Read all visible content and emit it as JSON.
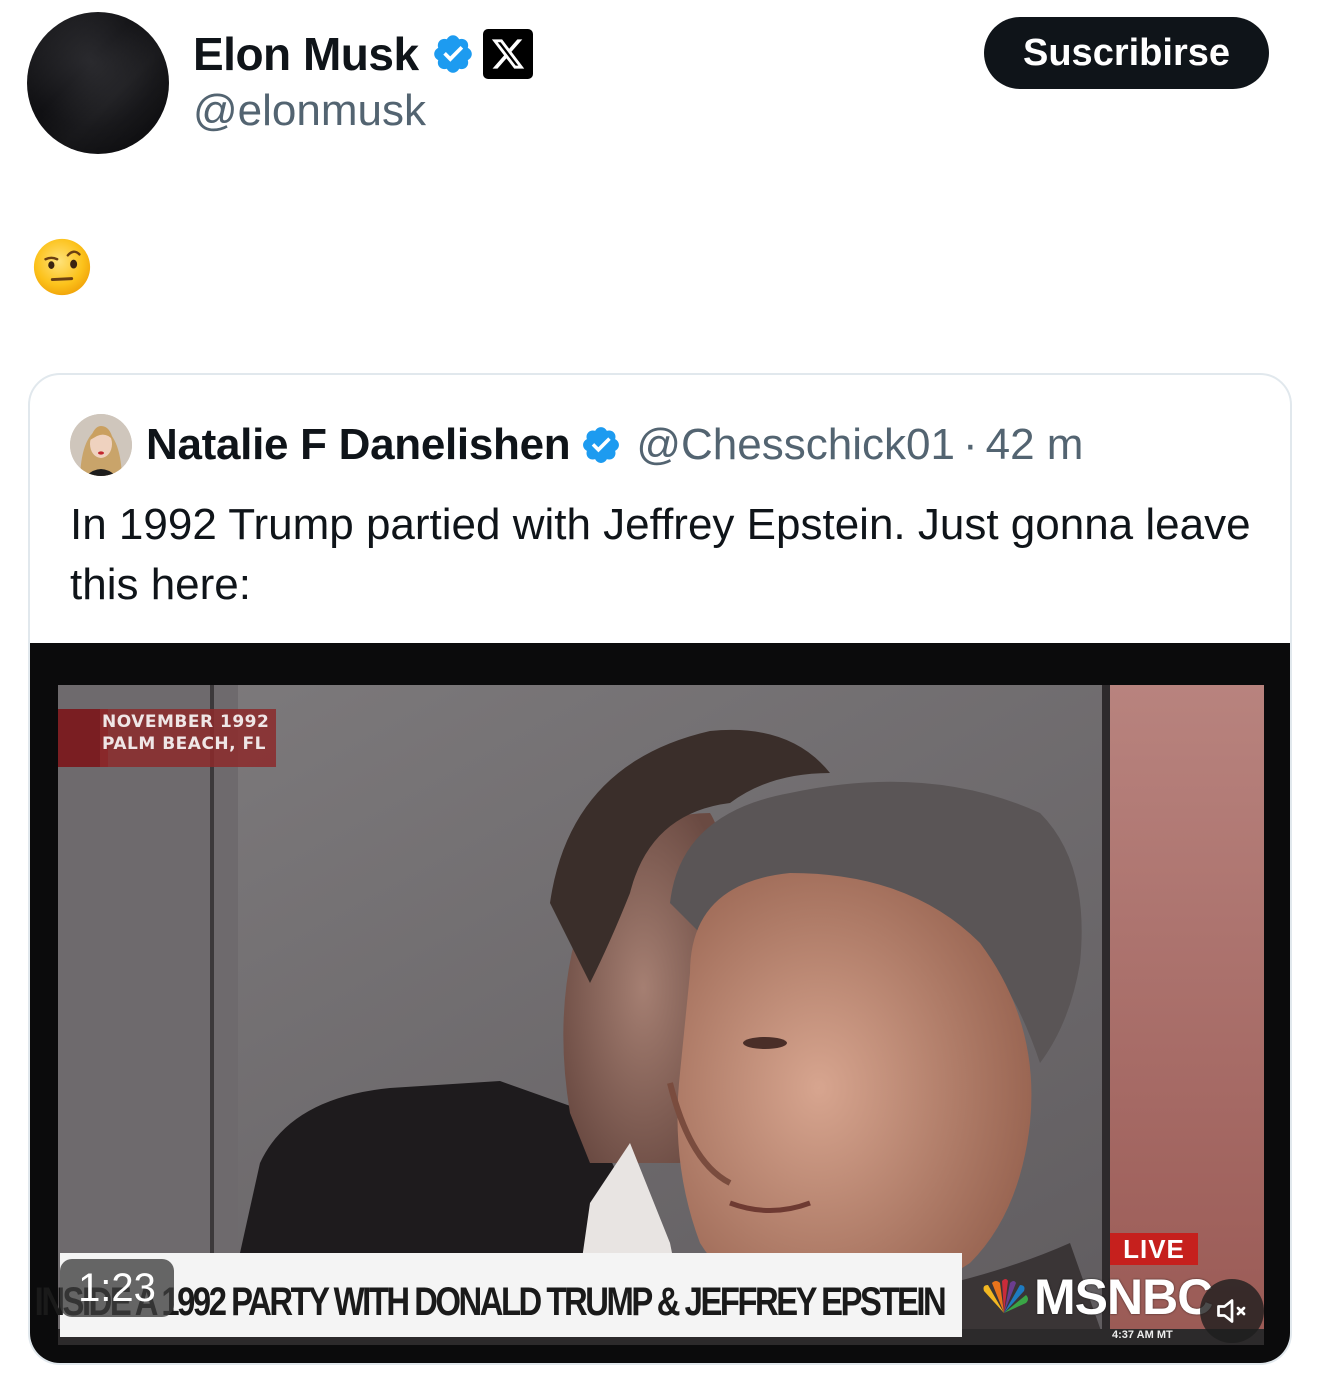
{
  "author": {
    "display_name": "Elon Musk",
    "handle": "@elonmusk",
    "affiliation_icon": "x-logo-icon",
    "verified_icon": "verified-badge-icon"
  },
  "header": {
    "subscribe_label": "Suscribirse"
  },
  "post": {
    "emoji": "face-with-raised-eyebrow-emoji"
  },
  "quoted": {
    "display_name": "Natalie F Danelishen",
    "handle": "@Chesschick01",
    "separator": "·",
    "time": "42 m",
    "text": "In 1992 Trump partied with Jeffrey Epstein. Just gonna leave this here:",
    "video": {
      "date_tag_line1": "NOVEMBER 1992",
      "date_tag_line2": "PALM BEACH, FL",
      "chyron": "INSIDE A 1992 PARTY WITH DONALD TRUMP & JEFFREY EPSTEIN",
      "live": "LIVE",
      "network": "MSNBC",
      "clock": "4:37 AM MT",
      "duration": "1:23",
      "mute_icon": "speaker-muted-icon"
    }
  },
  "colors": {
    "text_primary": "#0f1419",
    "text_secondary": "#536471",
    "verified_blue": "#1d9bf0",
    "button_bg": "#0f1419",
    "card_border": "#e1e8ed",
    "live_red": "#c6201d"
  }
}
